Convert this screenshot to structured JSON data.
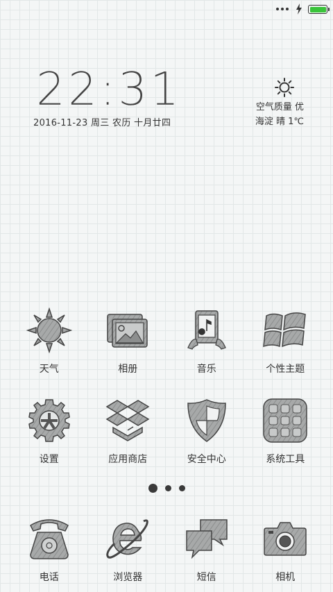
{
  "status_bar": {
    "signal_icon": "dots-icon",
    "charging_icon": "bolt-icon",
    "battery_level": 1.0,
    "battery_color": "#39c43a"
  },
  "lockscreen": {
    "time": "22:31",
    "date": "2016-11-23 周三 农历 十月廿四",
    "weather": {
      "icon": "sun-icon",
      "air_quality": "空气质量 优",
      "location_condition": "海淀 晴 1℃"
    }
  },
  "home": {
    "row1": [
      {
        "label": "天气",
        "icon": "sun-icon"
      },
      {
        "label": "相册",
        "icon": "gallery-icon"
      },
      {
        "label": "音乐",
        "icon": "music-icon"
      },
      {
        "label": "个性主题",
        "icon": "theme-windows-icon"
      }
    ],
    "row2": [
      {
        "label": "设置",
        "icon": "gear-icon"
      },
      {
        "label": "应用商店",
        "icon": "box-icon"
      },
      {
        "label": "安全中心",
        "icon": "shield-icon"
      },
      {
        "label": "系统工具",
        "icon": "tools-grid-icon"
      }
    ],
    "pager": {
      "pages": 3,
      "current": 1
    },
    "dock": [
      {
        "label": "电话",
        "icon": "phone-icon"
      },
      {
        "label": "浏览器",
        "icon": "browser-icon"
      },
      {
        "label": "短信",
        "icon": "messages-icon"
      },
      {
        "label": "相机",
        "icon": "camera-icon"
      }
    ]
  }
}
